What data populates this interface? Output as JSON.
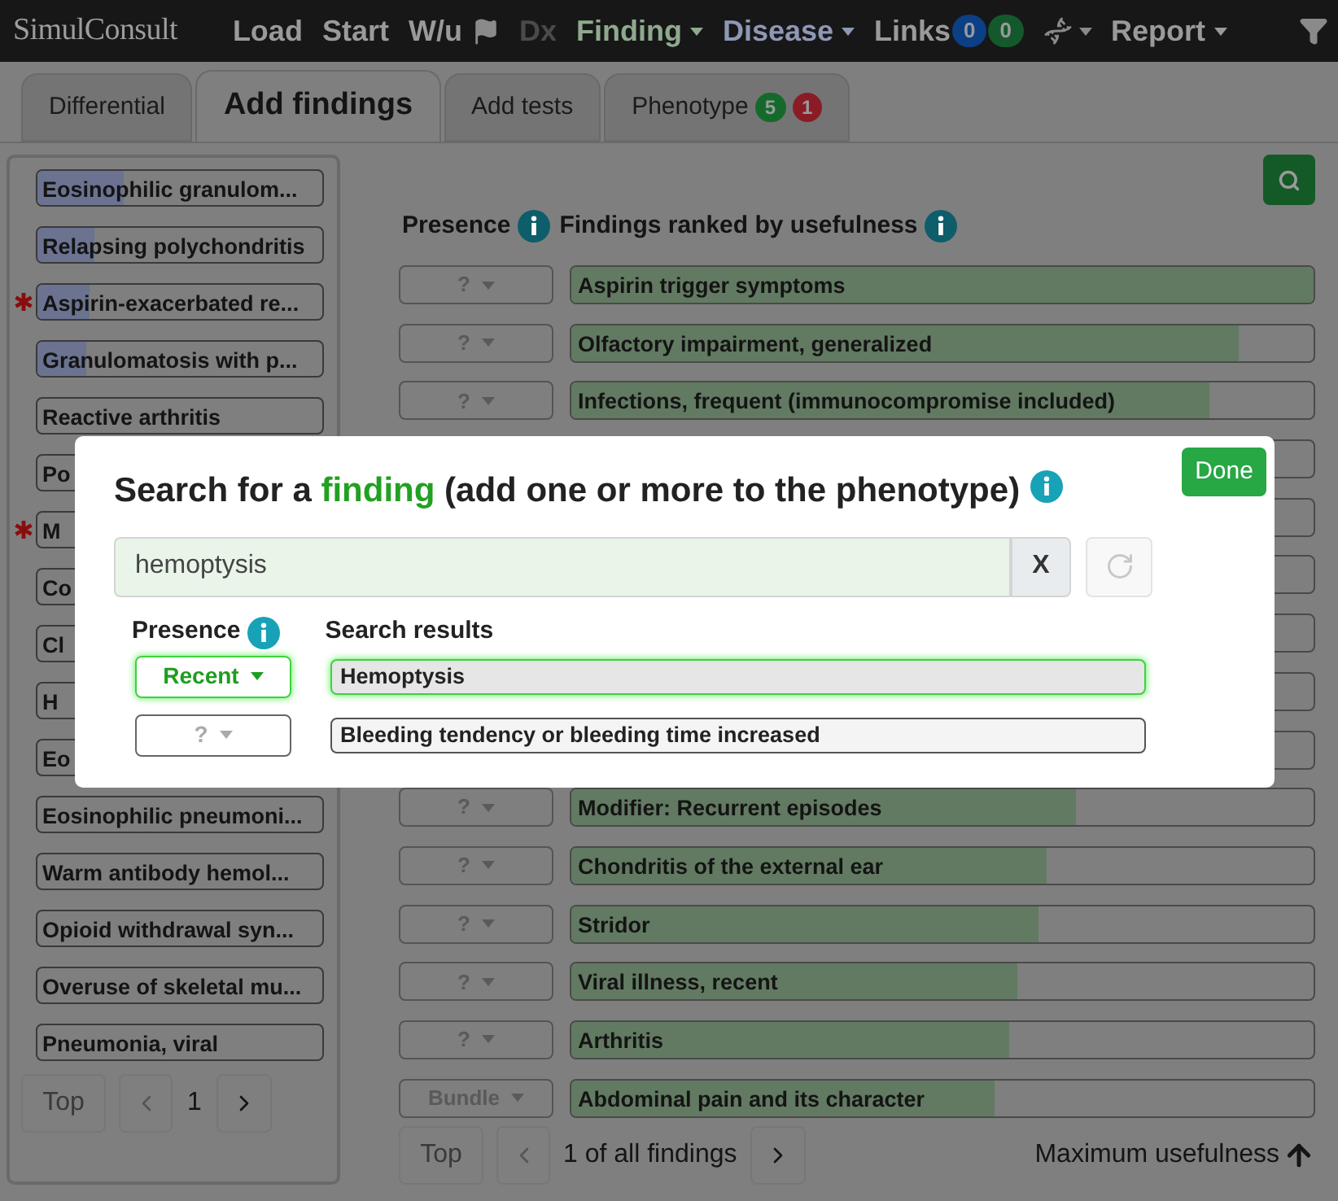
{
  "navbar": {
    "logo": "SimulConsult",
    "items": [
      {
        "kind": "link",
        "label": "Load",
        "disabled": false
      },
      {
        "kind": "link",
        "label": "Start",
        "disabled": false
      },
      {
        "kind": "link",
        "label": "W/u",
        "disabled": false
      },
      {
        "kind": "flag"
      },
      {
        "kind": "link",
        "label": "Dx",
        "disabled": true
      },
      {
        "kind": "menu",
        "label": "Finding",
        "color": "#8fa98f"
      },
      {
        "kind": "menu",
        "label": "Disease",
        "color": "#8e98b5"
      },
      {
        "kind": "links",
        "label": "Links",
        "badges": [
          {
            "text": "0",
            "color": "#0b3f86"
          },
          {
            "text": "0",
            "color": "#14592c"
          }
        ]
      },
      {
        "kind": "dna-menu"
      },
      {
        "kind": "menu",
        "label": "Report",
        "color": "#9a9a9a"
      },
      {
        "kind": "filter"
      }
    ]
  },
  "tabs": [
    {
      "label": "Differential",
      "selected": false
    },
    {
      "label": "Add findings",
      "selected": true
    },
    {
      "label": "Add tests",
      "selected": false
    },
    {
      "label": "Phenotype",
      "selected": false,
      "badges": [
        {
          "text": "5",
          "color": "#156a2b"
        },
        {
          "text": "1",
          "color": "#8a1c26"
        }
      ]
    }
  ],
  "diseases": {
    "items": [
      {
        "label": "Eosinophilic granulom...",
        "level": 0.3,
        "starred": false
      },
      {
        "label": "Relapsing polychondritis",
        "level": 0.2,
        "starred": false
      },
      {
        "label": "Aspirin-exacerbated re...",
        "level": 0.18,
        "starred": true
      },
      {
        "label": "Granulomatosis with p...",
        "level": 0.17,
        "starred": false
      },
      {
        "label": "Reactive arthritis",
        "level": 0,
        "starred": false
      },
      {
        "label": "Po",
        "level": 0,
        "starred": false
      },
      {
        "label": "M",
        "level": 0,
        "starred": true
      },
      {
        "label": "Co",
        "level": 0,
        "starred": false
      },
      {
        "label": "Cl",
        "level": 0,
        "starred": false
      },
      {
        "label": "H",
        "level": 0,
        "starred": false
      },
      {
        "label": "Eo",
        "level": 0,
        "starred": false
      },
      {
        "label": "Eosinophilic pneumoni...",
        "level": 0,
        "starred": false
      },
      {
        "label": "Warm antibody hemol...",
        "level": 0,
        "starred": false
      },
      {
        "label": "Opioid withdrawal syn...",
        "level": 0,
        "starred": false
      },
      {
        "label": "Overuse of skeletal mu...",
        "level": 0,
        "starred": false
      },
      {
        "label": "Pneumonia, viral",
        "level": 0,
        "starred": false
      }
    ],
    "pager": {
      "top": "Top",
      "page": "1"
    }
  },
  "findings": {
    "presence_header": "Presence",
    "ranked_header": "Findings ranked by usefulness",
    "rows": [
      {
        "kind": "row",
        "presence": "?",
        "label": "Aspirin trigger symptoms",
        "level": 1.0
      },
      {
        "kind": "row",
        "presence": "?",
        "label": "Olfactory impairment, generalized",
        "level": 0.9
      },
      {
        "kind": "row",
        "presence": "?",
        "label": "Infections, frequent (immunocompromise included)",
        "level": 0.86
      },
      {
        "kind": "covered"
      },
      {
        "kind": "covered"
      },
      {
        "kind": "covered"
      },
      {
        "kind": "covered"
      },
      {
        "kind": "covered"
      },
      {
        "kind": "covered"
      },
      {
        "kind": "row",
        "presence": "?",
        "label": "Modifier: Recurrent episodes",
        "level": 0.68
      },
      {
        "kind": "row",
        "presence": "?",
        "label": "Chondritis of the external ear",
        "level": 0.64
      },
      {
        "kind": "row",
        "presence": "?",
        "label": "Stridor",
        "level": 0.63
      },
      {
        "kind": "row",
        "presence": "?",
        "label": "Viral illness, recent",
        "level": 0.6
      },
      {
        "kind": "row",
        "presence": "?",
        "label": "Arthritis",
        "level": 0.59
      },
      {
        "kind": "row",
        "presence": "Bundle",
        "label": "Abdominal pain and its character",
        "level": 0.57
      }
    ],
    "pager": {
      "top": "Top",
      "status": "1 of all findings",
      "sort": "Maximum usefulness"
    }
  },
  "dialog": {
    "title_before": "Search for a ",
    "title_highlight": "finding",
    "title_after": " (add one or more to the phenotype)",
    "done": "Done",
    "search_value": "hemoptysis",
    "clear": "X",
    "presence_header": "Presence",
    "results_header": "Search results",
    "results": [
      {
        "presence": "Recent",
        "label": "Hemoptysis",
        "selected": true
      },
      {
        "presence": "?",
        "label": "Bleeding tendency or bleeding time increased",
        "selected": false
      }
    ]
  }
}
